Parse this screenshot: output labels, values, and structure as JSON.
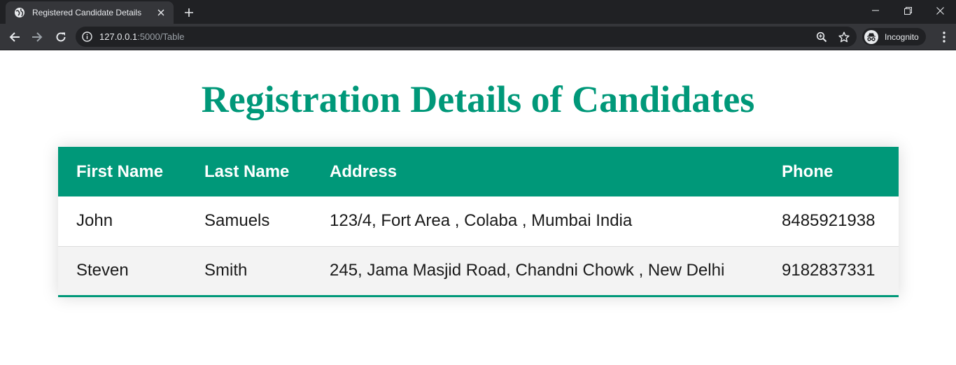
{
  "browser": {
    "tab_title": "Registered Candidate Details",
    "url_host": "127.0.0.1",
    "url_path": ":5000/Table",
    "profile_label": "Incognito"
  },
  "page": {
    "title": "Registration Details of Candidates",
    "accent_color": "#009879"
  },
  "table": {
    "headers": [
      "First Name",
      "Last Name",
      "Address",
      "Phone"
    ],
    "rows": [
      [
        "John",
        "Samuels",
        "123/4, Fort Area , Colaba , Mumbai India",
        "8485921938"
      ],
      [
        "Steven",
        "Smith",
        "245, Jama Masjid Road, Chandni Chowk , New Delhi",
        "9182837331"
      ]
    ]
  }
}
